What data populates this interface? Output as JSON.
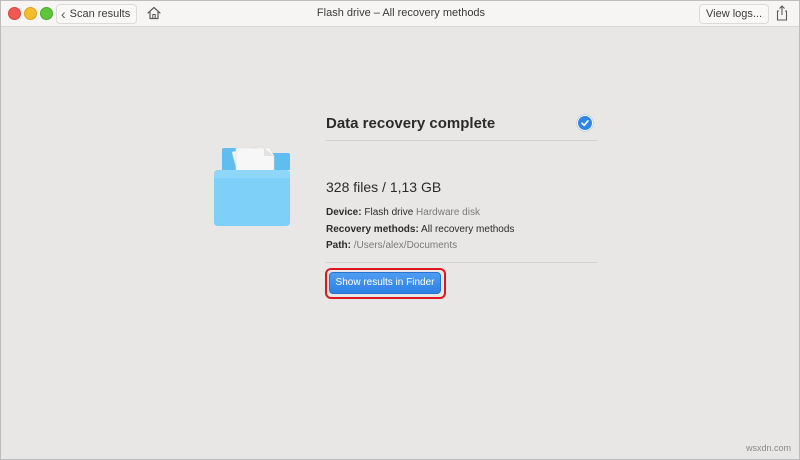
{
  "window": {
    "title": "Flash drive – All recovery methods",
    "back_label": "Scan results",
    "logs_label": "View logs...",
    "icons": [
      "home-icon",
      "share-icon",
      "chevron-left-icon",
      "folder-icon",
      "checkmark-icon"
    ]
  },
  "result": {
    "heading": "Data recovery complete",
    "files_summary": "328 files / 1,13 GB",
    "device_label": "Device:",
    "device_value": "Flash drive",
    "device_type": "Hardware disk",
    "methods_label": "Recovery methods:",
    "methods_value": "All recovery methods",
    "path_label": "Path:",
    "path_value": "/Users/alex/Documents",
    "finder_button": "Show results in Finder"
  },
  "watermark": "wsxdn.com",
  "colors": {
    "accent": "#2f86e6",
    "highlight": "#e0161f",
    "background": "#e9e7e5"
  }
}
